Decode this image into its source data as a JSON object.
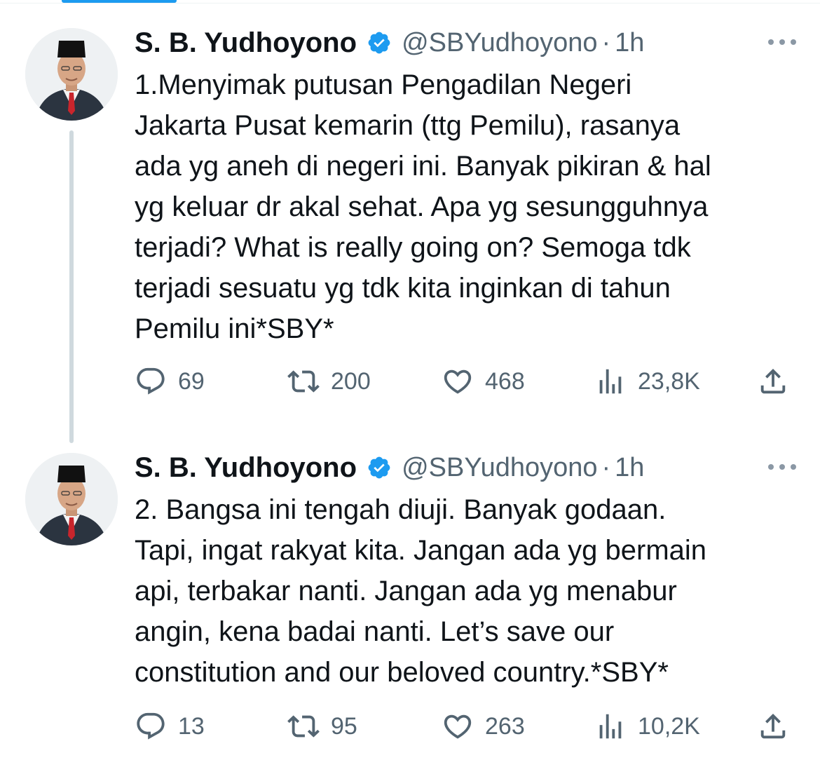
{
  "tweets": [
    {
      "display_name": "S. B. Yudhoyono",
      "handle": "@SBYudhoyono",
      "separator": "·",
      "time": "1h",
      "text": "1.Menyimak putusan Pengadilan Negeri\nJakarta Pusat kemarin (ttg Pemilu), rasanya\nada yg aneh di negeri ini. Banyak pikiran & hal\nyg keluar dr akal sehat. Apa yg sesungguhnya\nterjadi? What is really going on? Semoga tdk\nterjadi sesuatu yg tdk kita inginkan di tahun\nPemilu ini*SBY*",
      "stats": {
        "replies": "69",
        "retweets": "200",
        "likes": "468",
        "views": "23,8K"
      }
    },
    {
      "display_name": "S. B. Yudhoyono",
      "handle": "@SBYudhoyono",
      "separator": "·",
      "time": "1h",
      "text": "2. Bangsa ini tengah diuji. Banyak godaan.\nTapi, ingat rakyat kita. Jangan ada yg bermain\napi, terbakar nanti. Jangan ada yg menabur\nangin, kena badai nanti. Let’s save our\nconstitution and our beloved country.*SBY*",
      "stats": {
        "replies": "13",
        "retweets": "95",
        "likes": "263",
        "views": "10,2K"
      }
    }
  ],
  "icons": {
    "verified": "verified-badge-icon",
    "more": "more-options-icon",
    "reply": "reply-icon",
    "retweet": "retweet-icon",
    "like": "heart-icon",
    "views": "views-icon",
    "share": "share-icon"
  },
  "colors": {
    "accent": "#1d9bf0",
    "text_primary": "#0f1419",
    "text_secondary": "#536471",
    "thread_line": "#cfd9de"
  }
}
